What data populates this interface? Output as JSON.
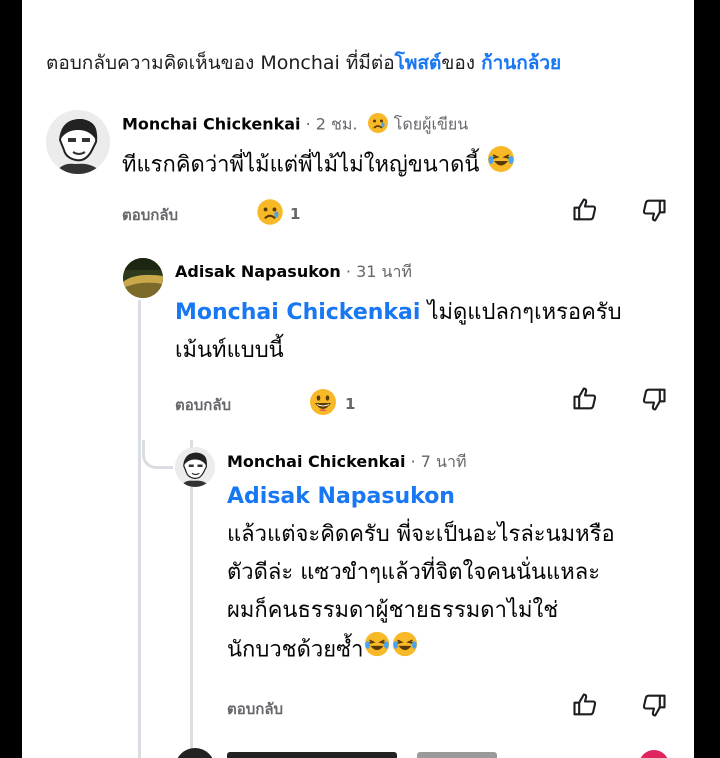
{
  "header": {
    "prefix": "ตอบกลับความคิดเห็นของ Monchai ที่มีต่อ",
    "post_link": "โพสต์",
    "of": "ของ ",
    "page_link": "ก้านกล้วย"
  },
  "comments": [
    {
      "author": "Monchai Chickenkai",
      "time": "· 2 ชม.",
      "badge": "โดยผู้เขียน",
      "text": "ทีแรกคิดว่าพี่ไม้แต่พี่ไม้ไม่ใหญ่ขนาดนี้",
      "reply_label": "ตอบกลับ",
      "reaction_count": "1"
    },
    {
      "author": "Adisak Napasukon",
      "time": "· 31 นาที",
      "mention": "Monchai Chickenkai",
      "text_line1": " ไม่ดูแปลกๆเหรอครับ",
      "text_line2": "เม้นท์แบบนี้",
      "reply_label": "ตอบกลับ",
      "reaction_count": "1"
    },
    {
      "author": "Monchai Chickenkai",
      "time": "· 7 นาที",
      "mention": "Adisak Napasukon",
      "lines": [
        "แล้วแต่จะคิดครับ  พี่จะเป็นอะไรล่ะนมหรือ",
        "ตัวดีล่ะ แซวขำๆแล้วที่จิตใจคนนั่นแหละ",
        "ผมก็คนธรรมดาผู้ชายธรรมดาไม่ใช่",
        "นักบวชด้วยซ้ำ"
      ],
      "reply_label": "ตอบกลับ"
    }
  ],
  "icons": {
    "like": "thumbs-up-icon",
    "dislike": "thumbs-down-icon",
    "sad": "sad-face-icon",
    "laugh": "laughing-face-icon",
    "grin": "grinning-face-icon"
  }
}
